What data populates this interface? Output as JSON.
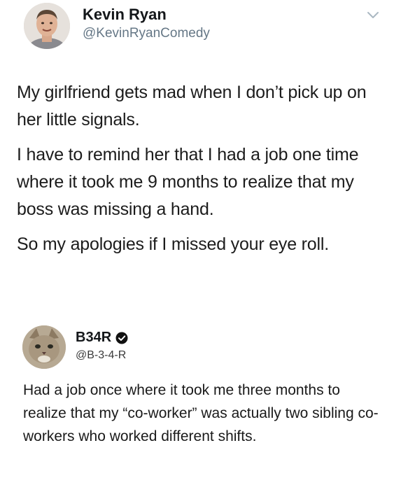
{
  "tweet": {
    "author_name": "Kevin Ryan",
    "author_handle": "@KevinRyanComedy",
    "avatar_icon": "person-photo",
    "menu_icon": "chevron-down-icon",
    "paragraphs": [
      "My girlfriend gets mad when I don’t pick up on her little signals.",
      "I have to remind her that I had a job one time where it took me 9 months to realize that my boss was missing a hand.",
      "So my apologies if I missed your eye roll."
    ]
  },
  "reply": {
    "author_name": "B34R",
    "author_handle": "@B-3-4-R",
    "avatar_icon": "cat-photo",
    "badge_icon": "verified-check-icon",
    "text": "Had a job once where it took me three months to realize that my “co-worker” was actually two sibling co-workers who worked different shifts."
  },
  "colors": {
    "text": "#14171a",
    "secondary_text": "#657786",
    "background": "#ffffff"
  }
}
